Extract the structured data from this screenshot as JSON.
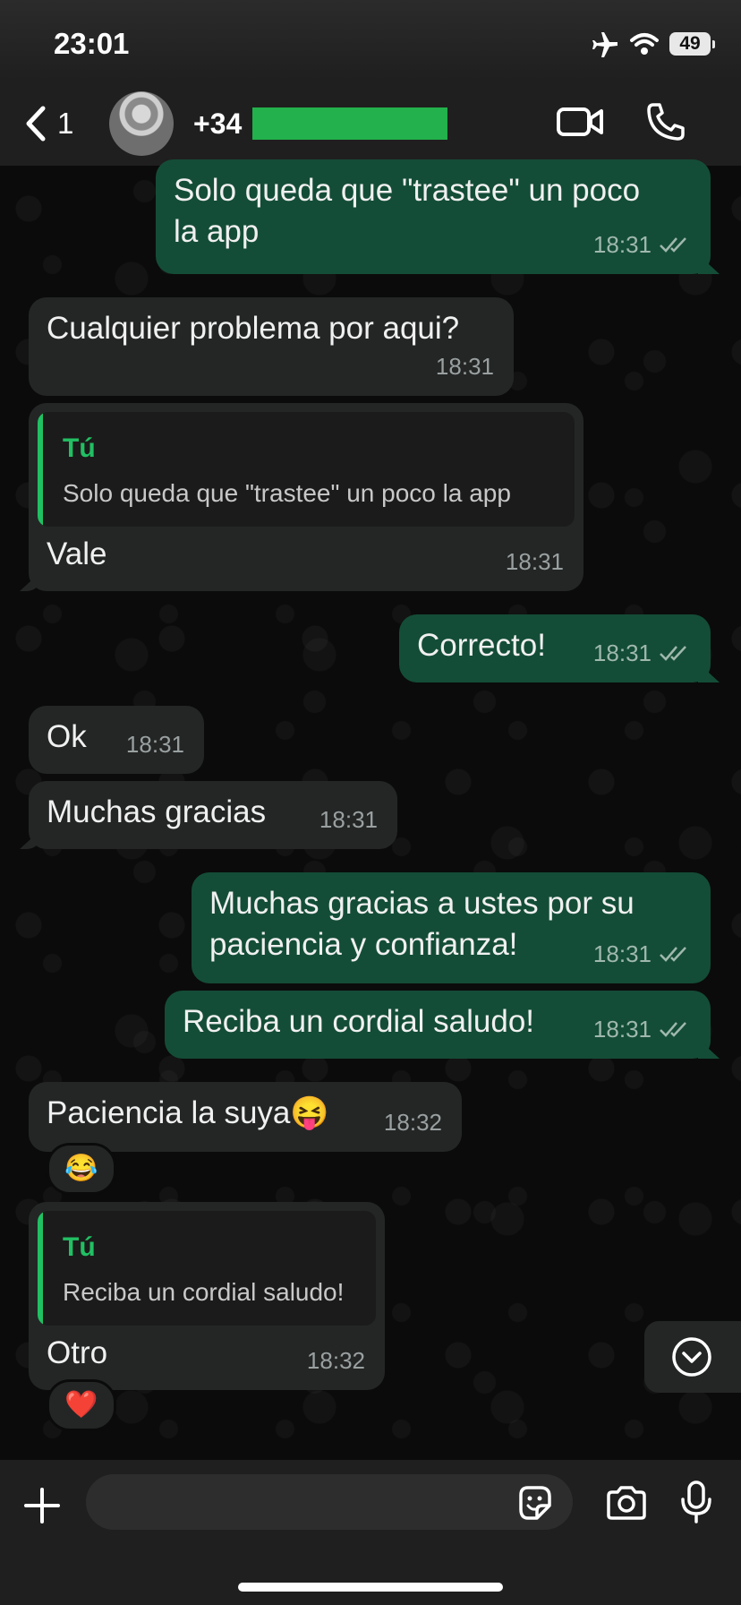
{
  "status_bar": {
    "time": "23:01",
    "battery": "49"
  },
  "header": {
    "back_count": "1",
    "contact_name": "+34"
  },
  "messages": [
    {
      "dir": "out",
      "text": "Solo queda que \"trastee\" un poco\nla app",
      "time": "18:31"
    },
    {
      "dir": "in",
      "text": "Cualquier problema por aqui?",
      "time": "18:31"
    },
    {
      "dir": "in",
      "quote_author": "Tú",
      "quote_text": "Solo queda que \"trastee\" un poco la app",
      "text": "Vale",
      "time": "18:31"
    },
    {
      "dir": "out",
      "text": "Correcto!",
      "time": "18:31"
    },
    {
      "dir": "in",
      "text": "Ok",
      "time": "18:31"
    },
    {
      "dir": "in",
      "text": "Muchas gracias",
      "time": "18:31"
    },
    {
      "dir": "out",
      "text": "Muchas gracias a ustes por su\npaciencia y confianza!",
      "time": "18:31"
    },
    {
      "dir": "out",
      "text": "Reciba un cordial saludo!",
      "time": "18:31"
    },
    {
      "dir": "in",
      "text": "Paciencia la suya😝",
      "time": "18:32",
      "reaction": "😂"
    },
    {
      "dir": "in",
      "quote_author": "Tú",
      "quote_text": "Reciba un cordial saludo!",
      "text": "Otro",
      "time": "18:32",
      "reaction": "❤️"
    }
  ],
  "composer": {
    "placeholder": "",
    "value": ""
  },
  "icons": {
    "back": "chevron-left-icon",
    "video": "video-camera-icon",
    "call": "phone-icon",
    "airplane": "airplane-icon",
    "wifi": "wifi-icon",
    "plus": "plus-icon",
    "sticker": "sticker-icon",
    "camera": "camera-icon",
    "mic": "microphone-icon",
    "scroll": "chevron-down-circle-icon"
  },
  "colors": {
    "outgoing": "#144d37",
    "incoming": "#242626",
    "accent": "#21c063",
    "redaction": "#22b14c"
  }
}
